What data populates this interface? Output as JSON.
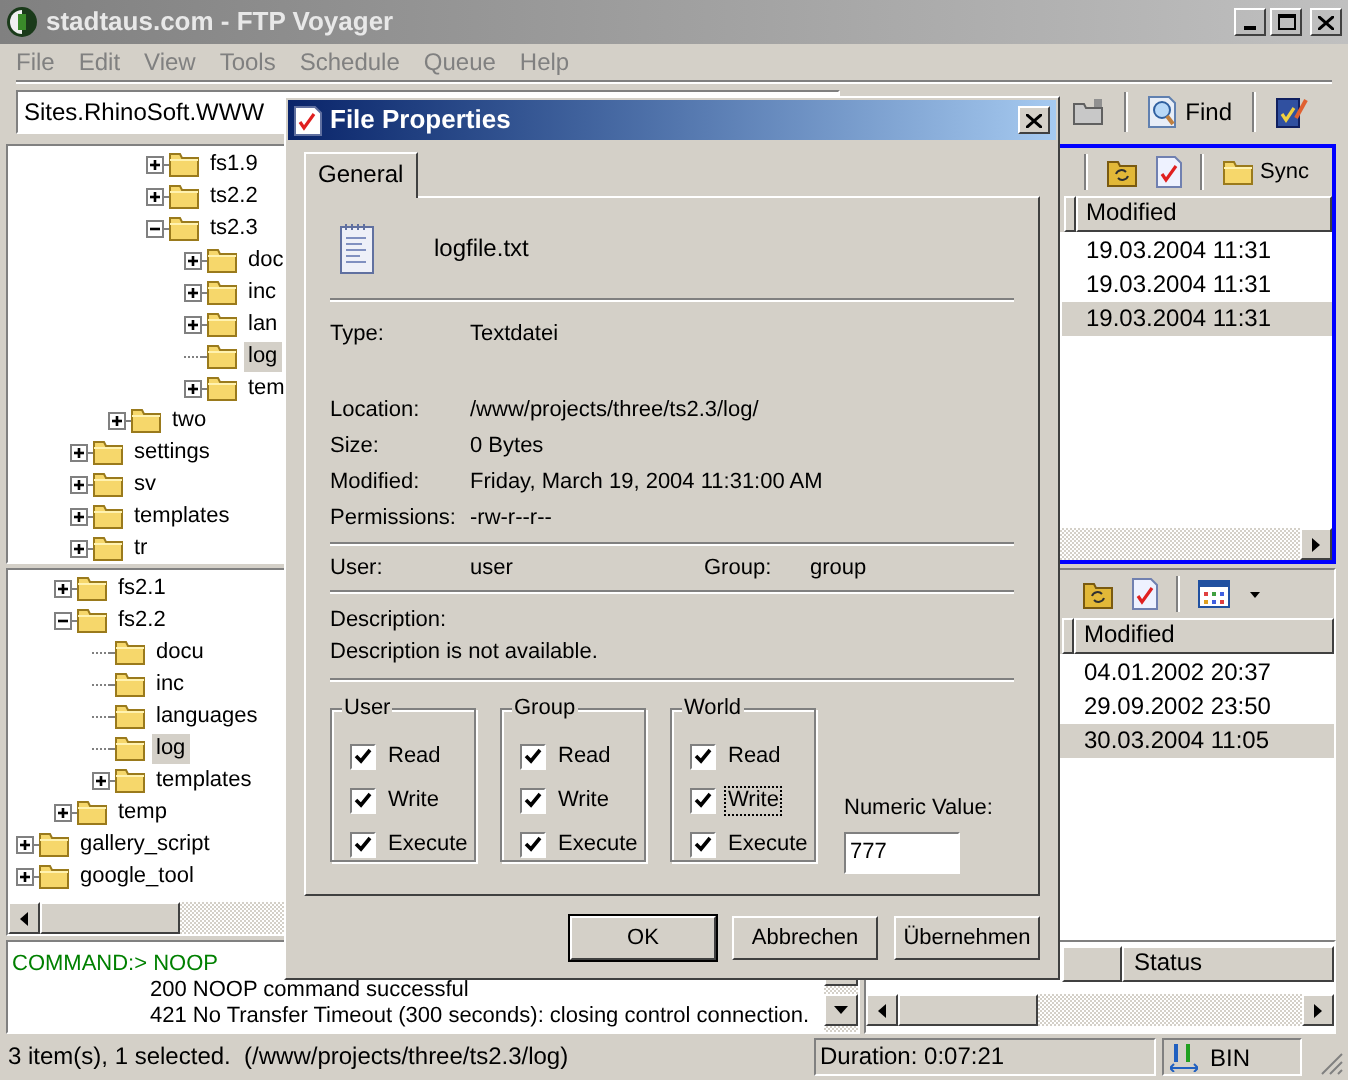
{
  "window": {
    "title": "stadtaus.com - FTP Voyager"
  },
  "menu": [
    "File",
    "Edit",
    "View",
    "Tools",
    "Schedule",
    "Queue",
    "Help"
  ],
  "site_combo": {
    "value": "Sites.RhinoSoft.WWW"
  },
  "toolbar": {
    "find_label": "Find"
  },
  "upper_tree": [
    {
      "children": [
        {
          "children": [
            {
              "label": "fs1.9",
              "selected": false,
              "expandable": true,
              "expanded": false
            },
            {
              "label": "ts2.2",
              "selected": false,
              "expandable": true,
              "expanded": false
            },
            {
              "label": "ts2.3",
              "selected": false,
              "expandable": true,
              "expanded": true,
              "children": [
                {
                  "label": "doc",
                  "selected": false,
                  "expandable": true,
                  "expanded": false
                },
                {
                  "label": "inc",
                  "selected": false,
                  "expandable": true,
                  "expanded": false
                },
                {
                  "label": "lan",
                  "selected": false,
                  "expandable": true,
                  "expanded": false
                },
                {
                  "label": "log",
                  "selected": true,
                  "expandable": false
                },
                {
                  "label": "tem",
                  "selected": false,
                  "expandable": true,
                  "expanded": false
                }
              ]
            }
          ]
        },
        {
          "label": "two",
          "selected": false,
          "expandable": true,
          "expanded": false
        }
      ]
    },
    {
      "label": "settings",
      "selected": false,
      "expandable": true,
      "expanded": false
    },
    {
      "label": "sv",
      "selected": false,
      "expandable": true,
      "expanded": false
    },
    {
      "label": "templates",
      "selected": false,
      "expandable": true,
      "expanded": false
    },
    {
      "label": "tr",
      "selected": false,
      "expandable": true,
      "expanded": false
    }
  ],
  "lower_tree": [
    {
      "children": [
        {
          "label": "fs2.1",
          "selected": false,
          "expandable": true,
          "expanded": false
        },
        {
          "label": "fs2.2",
          "selected": false,
          "expandable": true,
          "expanded": true,
          "children": [
            {
              "label": "docu",
              "selected": false,
              "expandable": false
            },
            {
              "label": "inc",
              "selected": false,
              "expandable": false
            },
            {
              "label": "languages",
              "selected": false,
              "expandable": false
            },
            {
              "label": "log",
              "selected": true,
              "expandable": false
            },
            {
              "label": "templates",
              "selected": false,
              "expandable": true,
              "expanded": false
            }
          ]
        },
        {
          "label": "temp",
          "selected": false,
          "expandable": true,
          "expanded": false
        }
      ]
    },
    {
      "label": "gallery_script",
      "selected": false,
      "expandable": true,
      "expanded": false
    },
    {
      "label": "google_tool",
      "selected": false,
      "expandable": true,
      "expanded": false
    }
  ],
  "upper_panel": {
    "active": true,
    "sync_label": "Sync",
    "column": "Modified",
    "rows": [
      {
        "modified": "19.03.2004 11:31",
        "selected": false
      },
      {
        "modified": "19.03.2004 11:31",
        "selected": false
      },
      {
        "modified": "19.03.2004 11:31",
        "selected": true
      }
    ]
  },
  "lower_panel": {
    "active": false,
    "column": "Modified",
    "rows": [
      {
        "modified": "04.01.2002 20:37",
        "selected": false
      },
      {
        "modified": "29.09.2002 23:50",
        "selected": false
      },
      {
        "modified": "30.03.2004 11:05",
        "selected": true
      }
    ]
  },
  "log": [
    {
      "kind": "command",
      "text": "COMMAND:> NOOP"
    },
    {
      "kind": "response",
      "text": "200 NOOP command successful"
    },
    {
      "kind": "response",
      "text": "421 No Transfer Timeout (300 seconds): closing control connection."
    }
  ],
  "queue": {
    "column": "Status"
  },
  "status_bar": {
    "message": "3 item(s), 1 selected.  (/www/projects/three/ts2.3/log)",
    "duration": "Duration: 0:07:21",
    "mode": "BIN"
  },
  "dialog": {
    "title": "File Properties",
    "tabs": [
      {
        "label": "General",
        "selected": true
      }
    ],
    "file_name": "logfile.txt",
    "type": {
      "label": "Type:",
      "value": "Textdatei"
    },
    "details": [
      {
        "label": "Location:",
        "value": "/www/projects/three/ts2.3/log/"
      },
      {
        "label": "Size:",
        "value": "0 Bytes"
      },
      {
        "label": "Modified:",
        "value": "Friday, March 19, 2004 11:31:00 AM"
      },
      {
        "label": "Permissions:",
        "value": "-rw-r--r--"
      }
    ],
    "user": {
      "label": "User:",
      "value": "user"
    },
    "group": {
      "label": "Group:",
      "value": "group"
    },
    "description": {
      "label": "Description:",
      "value": "Description is not available."
    },
    "permissions": [
      {
        "title": "User",
        "checks": [
          {
            "label": "Read",
            "checked": true,
            "focused": false
          },
          {
            "label": "Write",
            "checked": true,
            "focused": false
          },
          {
            "label": "Execute",
            "checked": true,
            "focused": false
          }
        ]
      },
      {
        "title": "Group",
        "checks": [
          {
            "label": "Read",
            "checked": true,
            "focused": false
          },
          {
            "label": "Write",
            "checked": true,
            "focused": false
          },
          {
            "label": "Execute",
            "checked": true,
            "focused": false
          }
        ]
      },
      {
        "title": "World",
        "checks": [
          {
            "label": "Read",
            "checked": true,
            "focused": false
          },
          {
            "label": "Write",
            "checked": true,
            "focused": true
          },
          {
            "label": "Execute",
            "checked": true,
            "focused": false
          }
        ]
      }
    ],
    "numeric": {
      "label": "Numeric Value:",
      "value": "777"
    },
    "buttons": [
      {
        "label": "OK",
        "default": true
      },
      {
        "label": "Abbrechen",
        "default": false
      },
      {
        "label": "Übernehmen",
        "default": false
      }
    ]
  }
}
